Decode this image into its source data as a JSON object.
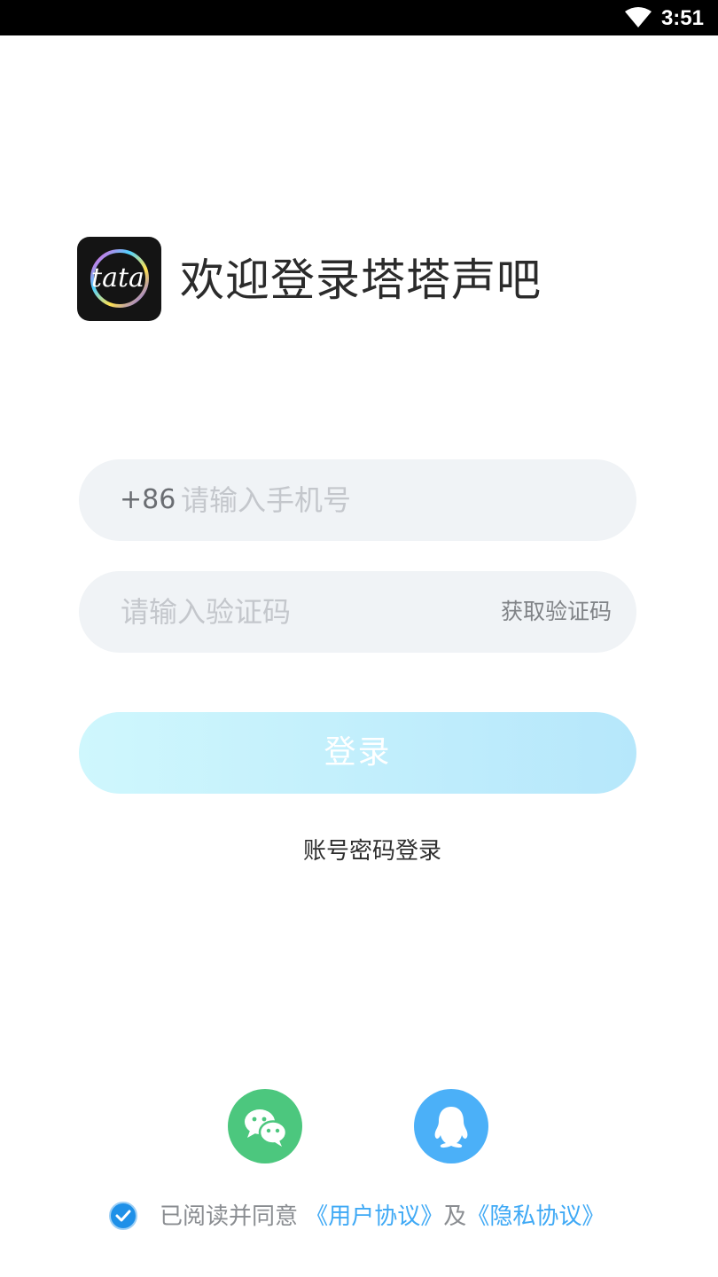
{
  "status_bar": {
    "time": "3:51",
    "wifi_icon": "wifi-icon"
  },
  "header": {
    "logo_icon": "tata-logo",
    "logo_text": "tata",
    "title": "欢迎登录塔塔声吧"
  },
  "phone_field": {
    "prefix": "+86",
    "placeholder": "请输入手机号",
    "value": ""
  },
  "code_field": {
    "placeholder": "请输入验证码",
    "value": "",
    "get_code_label": "获取验证码"
  },
  "login_button": {
    "label": "登录"
  },
  "password_login_label": "账号密码登录",
  "social": [
    {
      "name": "wechat",
      "icon": "wechat-icon",
      "color": "#4cc77e"
    },
    {
      "name": "qq",
      "icon": "qq-icon",
      "color": "#4bb0f8"
    }
  ],
  "agreement": {
    "checked": true,
    "prefix": "已阅读并同意",
    "user_agreement": "《用户协议》",
    "connector": "及",
    "privacy_agreement": "《隐私协议》"
  },
  "colors": {
    "accent": "#3fa9f5",
    "field_bg": "#f0f3f6",
    "login_gradient_start": "#cff7fd",
    "login_gradient_end": "#b6e7fb"
  }
}
